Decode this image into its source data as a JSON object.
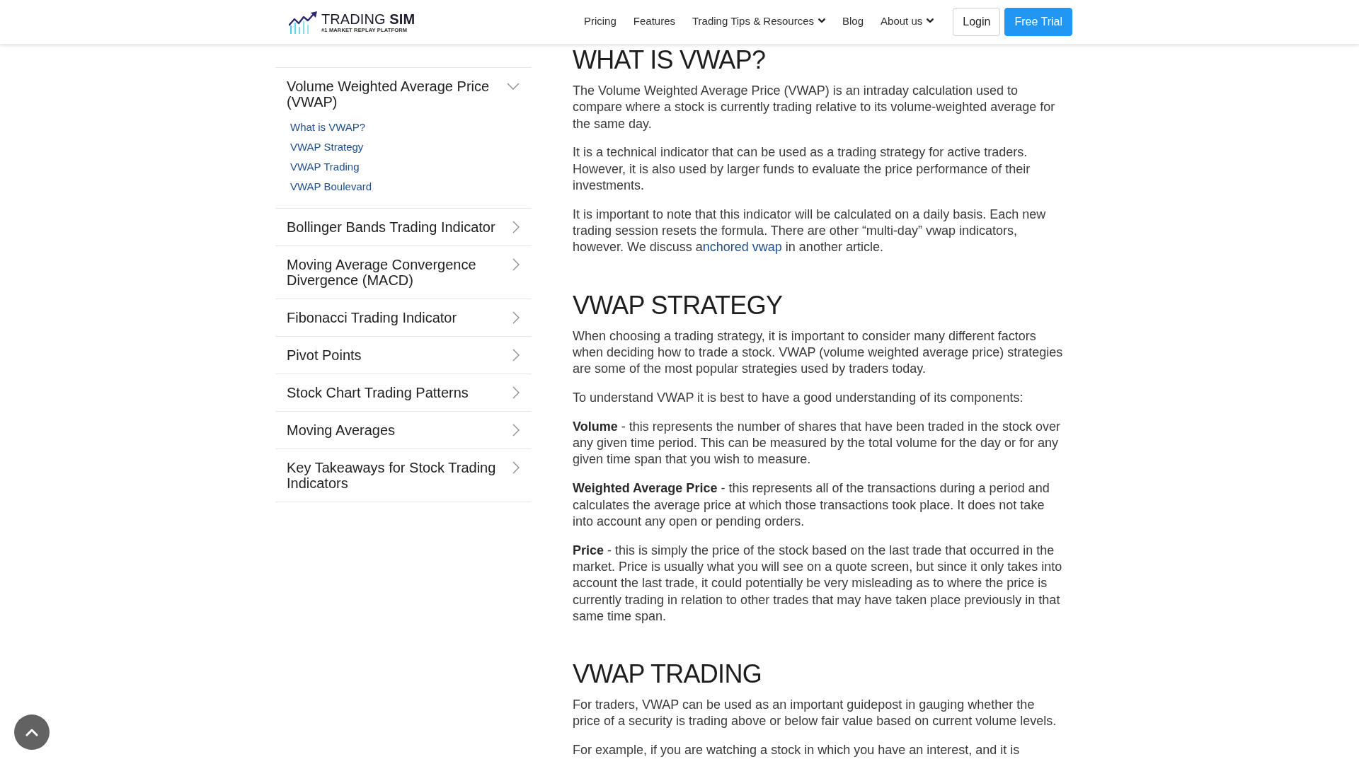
{
  "header": {
    "logo": {
      "wordmark": "TRADING **SIM**",
      "tagline": "#1 MARKET REPLAY PLATFORM"
    },
    "nav": [
      {
        "label": "Pricing",
        "dropdown": false
      },
      {
        "label": "Features",
        "dropdown": false
      },
      {
        "label": "Trading Tips & Resources",
        "dropdown": true
      },
      {
        "label": "Blog",
        "dropdown": false
      },
      {
        "label": "About us",
        "dropdown": true
      }
    ],
    "buttons": [
      {
        "label": "Login",
        "kind": "outline"
      },
      {
        "label": "Free Trial",
        "kind": "primary"
      }
    ]
  },
  "sidebar": {
    "items": [
      {
        "label": "Volume Weighted Average Price (VWAP)",
        "expanded": true,
        "children": [
          {
            "label": "What is VWAP?"
          },
          {
            "label": "VWAP Strategy"
          },
          {
            "label": "VWAP Trading"
          },
          {
            "label": "VWAP Boulevard"
          }
        ]
      },
      {
        "label": "Bollinger Bands Trading Indicator",
        "expanded": false
      },
      {
        "label": "Moving Average Convergence Divergence (MACD)",
        "expanded": false
      },
      {
        "label": "Fibonacci Trading Indicator",
        "expanded": false
      },
      {
        "label": "Pivot Points",
        "expanded": false
      },
      {
        "label": "Stock Chart Trading Patterns",
        "expanded": false
      },
      {
        "label": "Moving Averages",
        "expanded": false
      },
      {
        "label": "Key Takeaways for Stock Trading Indicators",
        "expanded": false
      }
    ]
  },
  "article": {
    "sections": [
      {
        "heading": "WHAT IS VWAP?",
        "paragraphs": [
          {
            "segments": [
              {
                "kind": "text",
                "text": "The Volume Weighted Average Price (VWAP) is an intraday calculation used to compare where a stock is currently trading relative to its volume-weighted average for the same day."
              }
            ]
          },
          {
            "segments": [
              {
                "kind": "text",
                "text": "It is a technical indicator that can be used as a trading strategy for active traders. However, it is also used by larger funds to evaluate the price performance of their investments."
              }
            ]
          },
          {
            "segments": [
              {
                "kind": "text",
                "text": "It is important to note that this indicator will be calculated on a daily basis. Each new trading session resets the formula. There are other “multi-day” vwap indicators, however. We discuss a"
              },
              {
                "kind": "link",
                "text": "nchored vwap"
              },
              {
                "kind": "text",
                "text": " in another article."
              }
            ]
          }
        ]
      },
      {
        "heading": "VWAP STRATEGY",
        "paragraphs": [
          {
            "segments": [
              {
                "kind": "text",
                "text": "When choosing a trading strategy, it is important to consider many different factors when deciding how to trade a stock. VWAP (volume weighted average price) strategies are some of the most popular strategies used by traders today."
              }
            ]
          },
          {
            "segments": [
              {
                "kind": "text",
                "text": "To understand VWAP it is best to have a good understanding of its components:"
              }
            ]
          },
          {
            "segments": [
              {
                "kind": "text",
                "text": "**Volume** - this represents the number of shares that have been traded in the stock over any given time period. This can be measured by the total volume for the day or for any given time span that you wish to measure."
              }
            ]
          },
          {
            "segments": [
              {
                "kind": "text",
                "text": "**Weighted Average Price** - this represents all of the transactions during a period and calculates the average price at which those transactions took place. It does not take into account any open or pending orders."
              }
            ]
          },
          {
            "segments": [
              {
                "kind": "text",
                "text": "**Price** - this is simply the price of the stock based on the last trade that occurred in the market. Price is usually what you will see on a quote screen, but since it only takes into account the last trade, it could potentially be very misleading as to where the price is currently trading in relation to other trades that may have taken place previously in that same time span."
              }
            ]
          }
        ]
      },
      {
        "heading": "VWAP TRADING",
        "paragraphs": [
          {
            "segments": [
              {
                "kind": "text",
                "text": "For traders, VWAP can be used as an important guidepost in gauging whether the price of a security is trading above or below fair value based on current volume levels."
              }
            ]
          },
          {
            "segments": [
              {
                "kind": "text",
                "text": "For example, if you are watching a stock in which you have an interest, and it is"
              }
            ]
          }
        ]
      }
    ]
  }
}
